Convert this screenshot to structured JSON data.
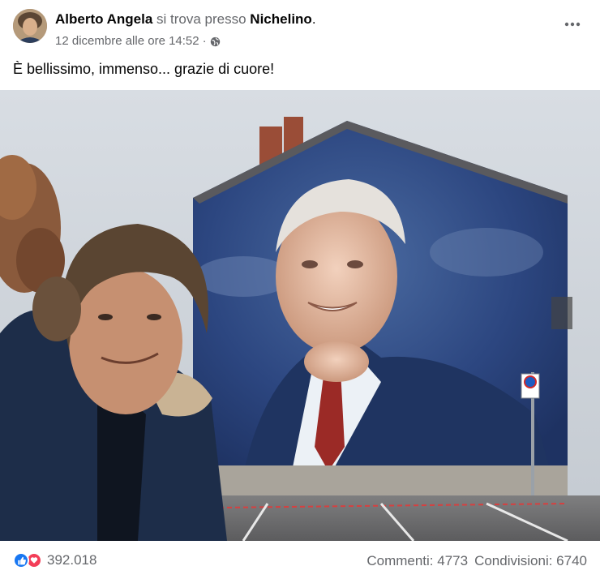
{
  "post": {
    "author": "Alberto Angela",
    "joiner": "si trova presso",
    "place": "Nichelino",
    "date": "12 dicembre alle ore 14:52",
    "separator": "·",
    "privacy_icon": "globe-icon",
    "more_icon": "more-options-icon",
    "caption": "È bellissimo, immenso... grazie di cuore!"
  },
  "photo": {
    "kind": "selfie in front of a large building mural portrait"
  },
  "footer": {
    "reaction_icons": [
      "like-icon",
      "love-icon"
    ],
    "reaction_count": "392.018",
    "comments": "Commenti: 4773",
    "shares": "Condivisioni: 6740"
  },
  "colors": {
    "text": "#050505",
    "secondary": "#65676b",
    "like": "#1877f2",
    "love": "#f33e58"
  }
}
